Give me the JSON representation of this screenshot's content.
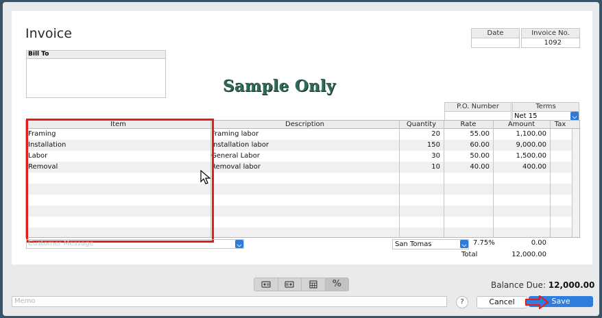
{
  "form": {
    "title": "Invoice",
    "date": {
      "label": "Date",
      "value": ""
    },
    "invoice_no": {
      "label": "Invoice No.",
      "value": "1092"
    },
    "bill_to_label": "Bill To",
    "watermark": "Sample Only",
    "po_number": {
      "label": "P.O. Number",
      "value": ""
    },
    "terms": {
      "label": "Terms",
      "value": "Net 15"
    }
  },
  "table": {
    "headers": [
      "Item",
      "Description",
      "Quantity",
      "Rate",
      "Amount",
      "Tax"
    ],
    "rows": [
      {
        "item": "Framing",
        "description": "Framing labor",
        "quantity": "20",
        "rate": "55.00",
        "amount": "1,100.00",
        "tax": ""
      },
      {
        "item": "Installation",
        "description": "Installation labor",
        "quantity": "150",
        "rate": "60.00",
        "amount": "9,000.00",
        "tax": ""
      },
      {
        "item": "Labor",
        "description": "General Labor",
        "quantity": "30",
        "rate": "50.00",
        "amount": "1,500.00",
        "tax": ""
      },
      {
        "item": "Removal",
        "description": "Removal labor",
        "quantity": "10",
        "rate": "40.00",
        "amount": "400.00",
        "tax": ""
      }
    ]
  },
  "bottom": {
    "customer_message_placeholder": "Customer Message",
    "tax_item": "San Tomas",
    "tax_rate": "7.75%",
    "tax_amount": "0.00",
    "total_label": "Total",
    "total_value": "12,000.00"
  },
  "footer": {
    "icons": [
      "customer-icon",
      "vendor-icon",
      "calculator-icon",
      "percent-icon"
    ],
    "percent_glyph": "%",
    "balance_label": "Balance Due:",
    "balance_value": "12,000.00",
    "memo_placeholder": "Memo",
    "help_label": "?",
    "cancel_label": "Cancel",
    "save_label": "Save"
  },
  "colors": {
    "highlight": "#e41c1c",
    "accent": "#2f7ddd",
    "watermark": "#2e6b5c"
  }
}
